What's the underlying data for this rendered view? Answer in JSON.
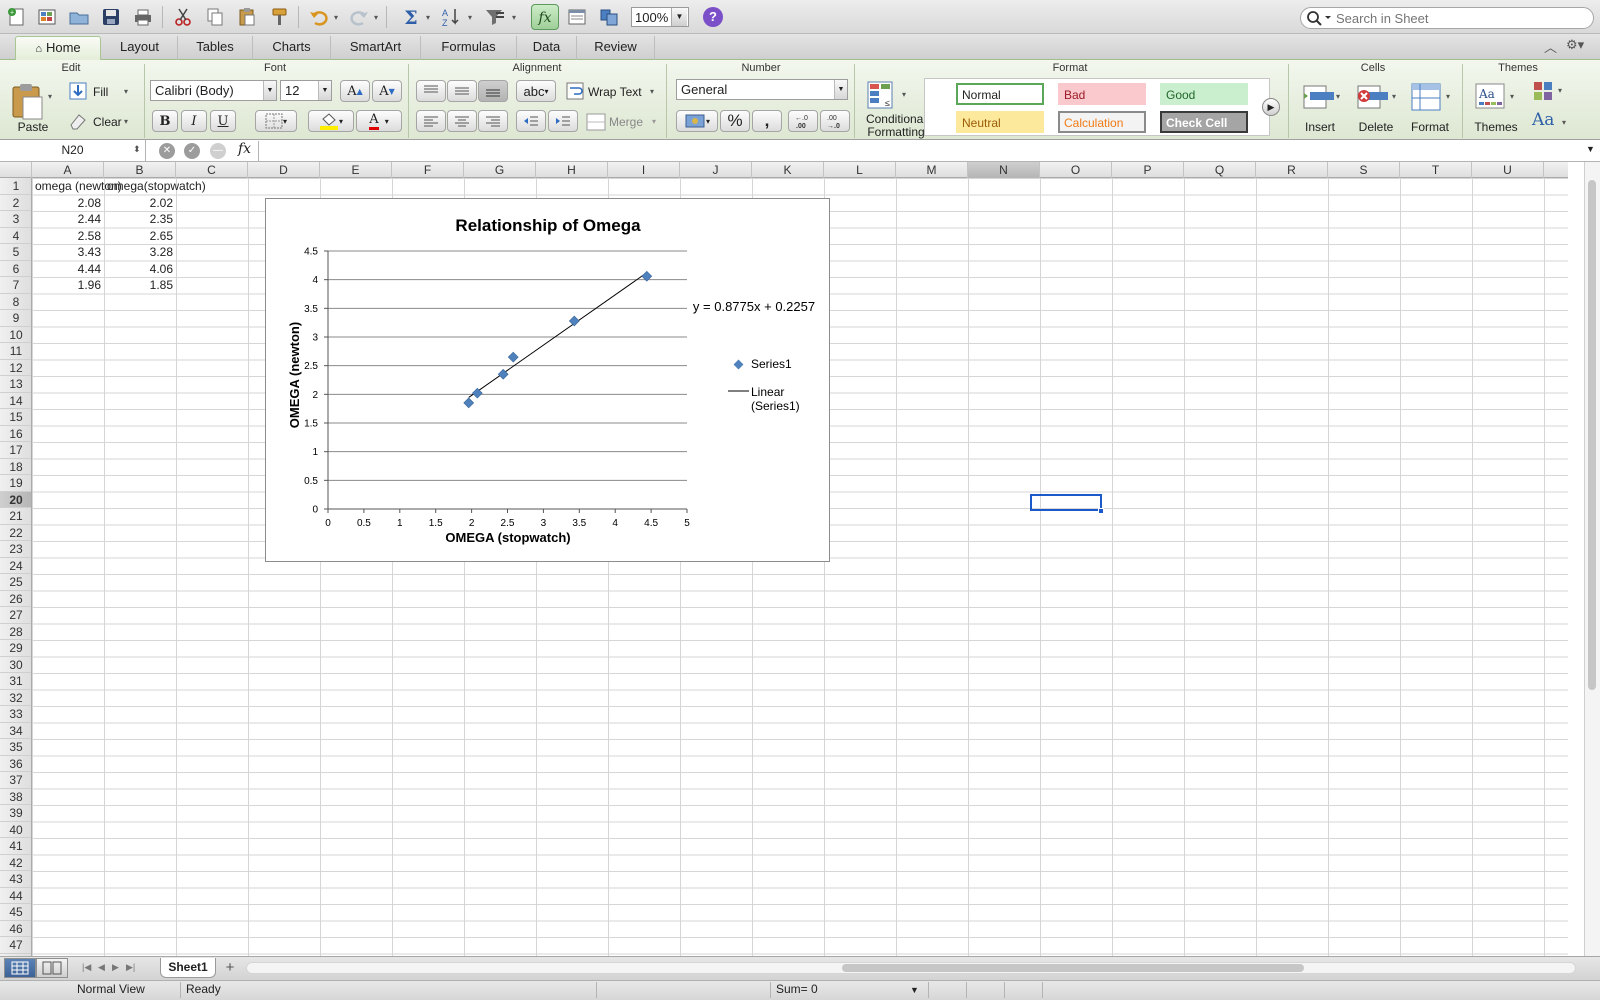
{
  "toolbar": {
    "zoom": "100%",
    "help": "?",
    "search_placeholder": "Search in Sheet"
  },
  "tabs": [
    {
      "label": "Home",
      "active": true
    },
    {
      "label": "Layout"
    },
    {
      "label": "Tables"
    },
    {
      "label": "Charts"
    },
    {
      "label": "SmartArt"
    },
    {
      "label": "Formulas"
    },
    {
      "label": "Data"
    },
    {
      "label": "Review"
    }
  ],
  "ribbon": {
    "groups": {
      "edit": "Edit",
      "font": "Font",
      "alignment": "Alignment",
      "number": "Number",
      "format": "Format",
      "cells": "Cells",
      "themes": "Themes"
    },
    "paste": "Paste",
    "fill": "Fill",
    "clear": "Clear",
    "font_name": "Calibri (Body)",
    "font_size": "12",
    "grow_font": "A",
    "shrink_font": "A",
    "bold": "B",
    "italic": "I",
    "underline": "U",
    "font_color": "A",
    "wrap_abc": "abc",
    "wrap_text": "Wrap Text",
    "merge": "Merge",
    "number_format": "General",
    "percent": "%",
    "comma": ",",
    "inc_decimal": "←.0\n.00",
    "dec_decimal": ".00\n→.0",
    "conditional_1": "Conditional",
    "conditional_2": "Formatting",
    "styles": [
      {
        "label": "Normal",
        "bg": "#ffffff",
        "fg": "#222222",
        "border": "#5aa75a"
      },
      {
        "label": "Bad",
        "bg": "#f9c9cd",
        "fg": "#9c1b26",
        "border": "#f9c9cd"
      },
      {
        "label": "Good",
        "bg": "#c9efce",
        "fg": "#23682b",
        "border": "#c9efce"
      },
      {
        "label": "Neutral",
        "bg": "#fde99b",
        "fg": "#9b5b07",
        "border": "#fde99b"
      },
      {
        "label": "Calculation",
        "bg": "#f3f3f3",
        "fg": "#f07b16",
        "border": "#8a8a8a"
      },
      {
        "label": "Check Cell",
        "bg": "#a5a5a5",
        "fg": "#ffffff",
        "border": "#3a3a3a"
      }
    ],
    "insert": "Insert",
    "delete": "Delete",
    "format": "Format",
    "themes": "Themes",
    "theme_font": "Aa"
  },
  "formula_bar": {
    "name_box": "N20",
    "fx": "fx",
    "value": ""
  },
  "columns": [
    "A",
    "B",
    "C",
    "D",
    "E",
    "F",
    "G",
    "H",
    "I",
    "J",
    "K",
    "L",
    "M",
    "N",
    "O",
    "P",
    "Q",
    "R",
    "S",
    "T",
    "U"
  ],
  "selected_column": "N",
  "selected_row": 20,
  "row_count": 47,
  "cells": {
    "headers": [
      "omega (newton)",
      "omega(stopwatch)"
    ],
    "rows": [
      [
        "2.08",
        "2.02"
      ],
      [
        "2.44",
        "2.35"
      ],
      [
        "2.58",
        "2.65"
      ],
      [
        "3.43",
        "3.28"
      ],
      [
        "4.44",
        "4.06"
      ],
      [
        "1.96",
        "1.85"
      ]
    ]
  },
  "chart_data": {
    "type": "scatter",
    "title": "Relationship of Omega",
    "xlabel": "OMEGA (stopwatch)",
    "ylabel": "OMEGA (newton)",
    "xlim": [
      0,
      5
    ],
    "ylim": [
      0,
      4.5
    ],
    "x_ticks": [
      "0",
      "0.5",
      "1",
      "1.5",
      "2",
      "2.5",
      "3",
      "3.5",
      "4",
      "4.5",
      "5"
    ],
    "y_ticks": [
      "0",
      "0.5",
      "1",
      "1.5",
      "2",
      "2.5",
      "3",
      "3.5",
      "4",
      "4.5"
    ],
    "grid": "horizontal",
    "series": [
      {
        "name": "Series1",
        "x": [
          2.08,
          2.44,
          2.58,
          3.43,
          4.44,
          1.96
        ],
        "y": [
          2.02,
          2.35,
          2.65,
          3.28,
          4.06,
          1.85
        ],
        "color": "#4f81bd"
      }
    ],
    "trendline": {
      "name": "Linear (Series1)",
      "name_line1": "Linear",
      "name_line2": "(Series1)",
      "slope": 0.8775,
      "intercept": 0.2257,
      "x_range": [
        1.96,
        4.44
      ],
      "equation": "y = 0.8775x + 0.2257"
    },
    "legend": "right"
  },
  "sheet_tab": "Sheet1",
  "status": {
    "view": "Normal View",
    "state": "Ready",
    "sum": "Sum= 0"
  }
}
